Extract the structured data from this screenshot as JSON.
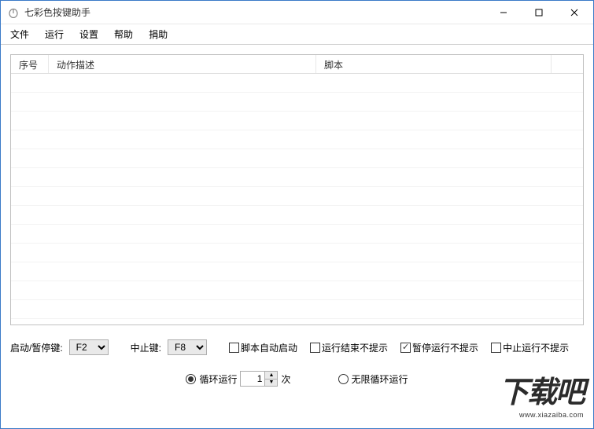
{
  "window": {
    "title": "七彩色按键助手",
    "controls": {
      "min": "—",
      "max": "☐",
      "close": "✕"
    }
  },
  "menubar": {
    "items": [
      "文件",
      "运行",
      "设置",
      "帮助",
      "捐助"
    ]
  },
  "table": {
    "headers": [
      "序号",
      "动作描述",
      "脚本",
      ""
    ]
  },
  "hotkeys": {
    "start_pause_label": "启动/暂停键:",
    "start_pause_value": "F2",
    "stop_label": "中止键:",
    "stop_value": "F8"
  },
  "checkboxes": [
    {
      "label": "脚本自动启动",
      "checked": false
    },
    {
      "label": "运行结束不提示",
      "checked": false
    },
    {
      "label": "暂停运行不提示",
      "checked": true
    },
    {
      "label": "中止运行不提示",
      "checked": false
    }
  ],
  "loop": {
    "loop_run_label": "循环运行",
    "count": "1",
    "times_label": "次",
    "infinite_label": "无限循环运行",
    "mode": "count"
  },
  "watermark": {
    "main": "下载吧",
    "sub": "www.xiazaiba.com"
  }
}
